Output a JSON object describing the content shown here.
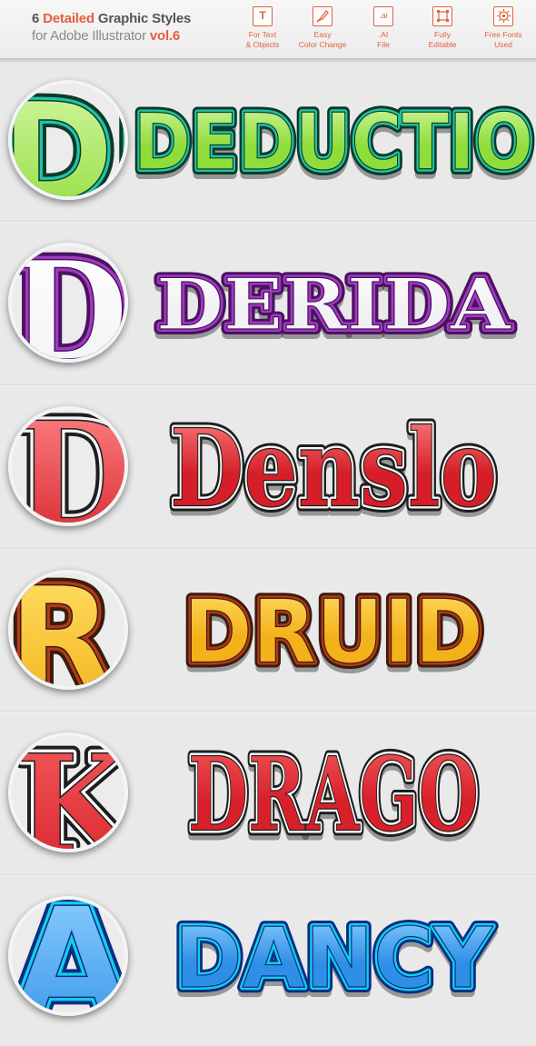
{
  "header": {
    "title_num": "6",
    "title_accent": "Detailed",
    "title_rest": "Graphic Styles",
    "subtitle": "for Adobe Illustrator",
    "volume": "vol.6"
  },
  "features": [
    {
      "icon": "text-icon",
      "glyph": "T",
      "label": "For Text\n& Objects"
    },
    {
      "icon": "brush-icon",
      "glyph": "",
      "label": "Easy\nColor Change"
    },
    {
      "icon": "ai-file-icon",
      "glyph": ".ai",
      "label": ".AI\nFile"
    },
    {
      "icon": "editable-icon",
      "glyph": "",
      "label": "Fully\nEditable"
    },
    {
      "icon": "fonts-icon",
      "glyph": "",
      "label": "Free Fonts\nUsed"
    }
  ],
  "styles": [
    {
      "word": "DEDUCTIO",
      "circle_letters": "DE",
      "fill": "#8fdd3a",
      "fill_light": "#d4f7a4",
      "stroke": "#22c4a4",
      "outline": "#0c3a2a",
      "font": "sans"
    },
    {
      "word": "DERIDA",
      "circle_letters": "D",
      "fill": "#f2f2f6",
      "fill_light": "#ffffff",
      "stroke": "#a13bbf",
      "outline": "#4a1261",
      "font": "serif"
    },
    {
      "word": "Denslo",
      "circle_letters": "D",
      "fill": "#d51e27",
      "fill_light": "#ff8a8a",
      "stroke": "#f4f4f4",
      "outline": "#1e1e1e",
      "font": "serif"
    },
    {
      "word": "DRUID",
      "circle_letters": "R",
      "fill": "#f3b21a",
      "fill_light": "#ffe066",
      "stroke": "#b4391b",
      "outline": "#3a1c0e",
      "font": "sans"
    },
    {
      "word": "DRAGO",
      "circle_letters": "K",
      "fill": "#d8202a",
      "fill_light": "#f25c5c",
      "stroke": "#ffffff",
      "outline": "#1e1e1e",
      "font": "serif"
    },
    {
      "word": "DANCY",
      "circle_letters": "A",
      "fill": "#2f8fe6",
      "fill_light": "#8fd2ff",
      "stroke": "#13d0ea",
      "outline": "#0a2e86",
      "font": "sans"
    }
  ]
}
